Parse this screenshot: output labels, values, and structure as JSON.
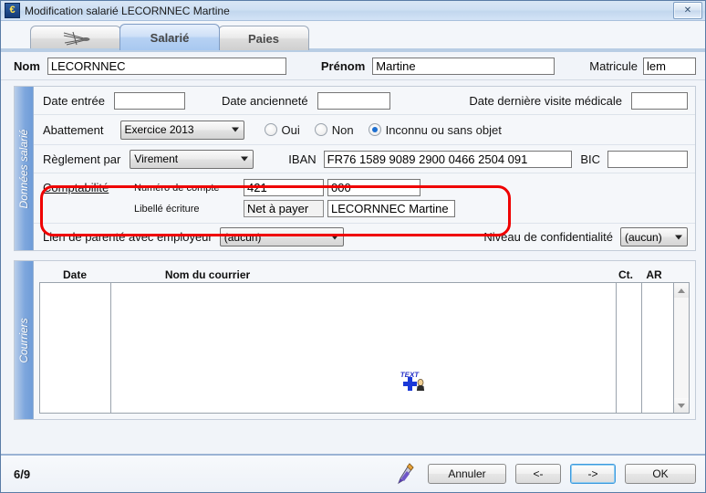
{
  "window": {
    "title": "Modification salarié LECORNNEC Martine",
    "app_icon": "euro-icon",
    "close_label": "✕"
  },
  "tabs": [
    {
      "id": "icon",
      "label": "",
      "icon": "dragonfly-icon",
      "active": false
    },
    {
      "id": "salarie",
      "label": "Salarié",
      "active": true
    },
    {
      "id": "paies",
      "label": "Paies",
      "active": false
    }
  ],
  "header": {
    "nom_label": "Nom",
    "nom_value": "LECORNNEC",
    "prenom_label": "Prénom",
    "prenom_value": "Martine",
    "matricule_label": "Matricule",
    "matricule_value": "lem"
  },
  "donnees_salarie": {
    "section_label": "Données salarié",
    "date_entree_label": "Date entrée",
    "date_entree_value": "",
    "date_anciennete_label": "Date ancienneté",
    "date_anciennete_value": "",
    "date_visite_label": "Date dernière visite médicale",
    "date_visite_value": "",
    "abattement_label": "Abattement",
    "abattement_value": "Exercice 2013",
    "radios": [
      {
        "label": "Oui",
        "selected": false
      },
      {
        "label": "Non",
        "selected": false
      },
      {
        "label": "Inconnu ou sans objet",
        "selected": true
      }
    ],
    "reglement_label": "Règlement par",
    "reglement_value": "Virement",
    "iban_label": "IBAN",
    "iban_value": "FR76 1589 9089 2900 0466 2504 091",
    "bic_label": "BIC",
    "bic_value": "",
    "comptabilite": {
      "title": "Comptabilité",
      "numero_compte_label": "Numéro de compte",
      "numero_compte_1": "421",
      "numero_compte_2": "000",
      "libelle_ecriture_label": "Libellé écriture",
      "libelle_ecriture_1": "Net à payer",
      "libelle_ecriture_2": "LECORNNEC Martine",
      "highlight_color": "#ef0000"
    },
    "lien_parente_label": "Lien de parenté avec employeur",
    "lien_parente_value": "(aucun)",
    "confidentialite_label": "Niveau de confidentialité",
    "confidentialite_value": "(aucun)"
  },
  "courriers": {
    "section_label": "Courriers",
    "columns": [
      "Date",
      "Nom du courrier",
      "Ct.",
      "AR"
    ],
    "rows": [],
    "add_icon": "add-text-icon"
  },
  "footer": {
    "page_indicator": "6/9",
    "pencil_icon": "pencil-icon",
    "cancel_label": "Annuler",
    "prev_label": "<-",
    "next_label": "->",
    "ok_label": "OK"
  }
}
